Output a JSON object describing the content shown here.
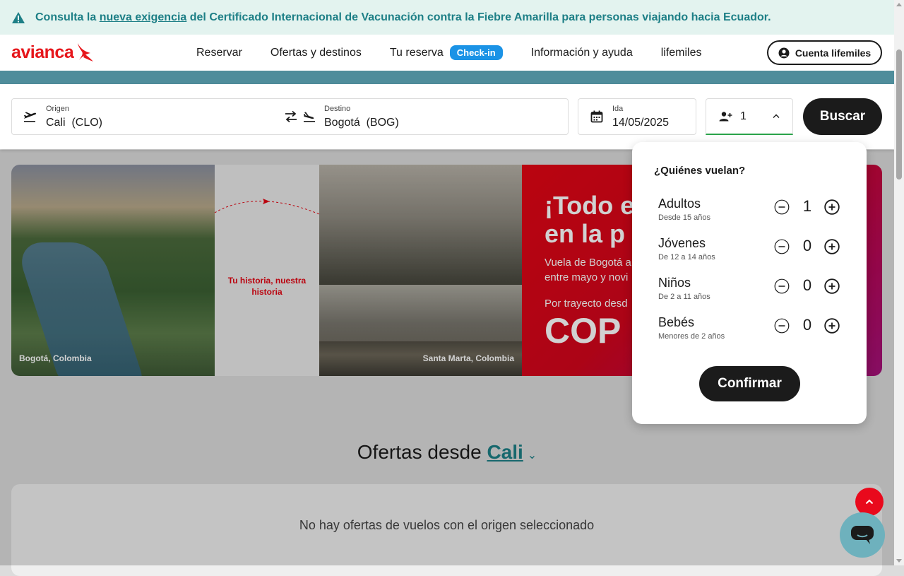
{
  "alert": {
    "before": "Consulta la ",
    "link": "nueva exigencia",
    "after": " del Certificado Internacional de Vacunación contra la Fiebre Amarilla para personas viajando hacia Ecuador."
  },
  "header": {
    "logo": "avianca",
    "nav": [
      "Reservar",
      "Ofertas y destinos",
      "Tu reserva",
      "Información y ayuda",
      "lifemiles"
    ],
    "checkin_badge": "Check-in",
    "account_button": "Cuenta lifemiles"
  },
  "search": {
    "origin_label": "Origen",
    "origin_value": "Cali  (CLO)",
    "destination_label": "Destino",
    "destination_value": "Bogotá  (BOG)",
    "date_label": "Ida",
    "date_value": "14/05/2025",
    "passengers_value": "1",
    "search_button": "Buscar"
  },
  "hero": {
    "caption_left": "Bogotá, Colombia",
    "middle_text": "Tu historia, nuestra historia",
    "caption_right": "Santa Marta, Colombia",
    "promo_title": "¡Todo e\nen la p",
    "promo_sub": "Vuela de Bogotá a\nentre mayo y novi",
    "promo_per": "Por trayecto desd",
    "promo_price": "COP"
  },
  "offers": {
    "title_prefix": "Ofertas desde ",
    "city": "Cali",
    "empty": "No hay ofertas de vuelos con el origen seleccionado"
  },
  "passengers_popover": {
    "question": "¿Quiénes vuelan?",
    "rows": [
      {
        "name": "Adultos",
        "age": "Desde 15 años",
        "count": "1"
      },
      {
        "name": "Jóvenes",
        "age": "De 12 a 14 años",
        "count": "0"
      },
      {
        "name": "Niños",
        "age": "De 2 a 11 años",
        "count": "0"
      },
      {
        "name": "Bebés",
        "age": "Menores de 2 años",
        "count": "0"
      }
    ],
    "confirm_button": "Confirmar"
  },
  "colors": {
    "brand_red": "#e6161b",
    "teal": "#1d7f86",
    "checkin_blue": "#1b93e6",
    "dark": "#1b1b1b"
  }
}
